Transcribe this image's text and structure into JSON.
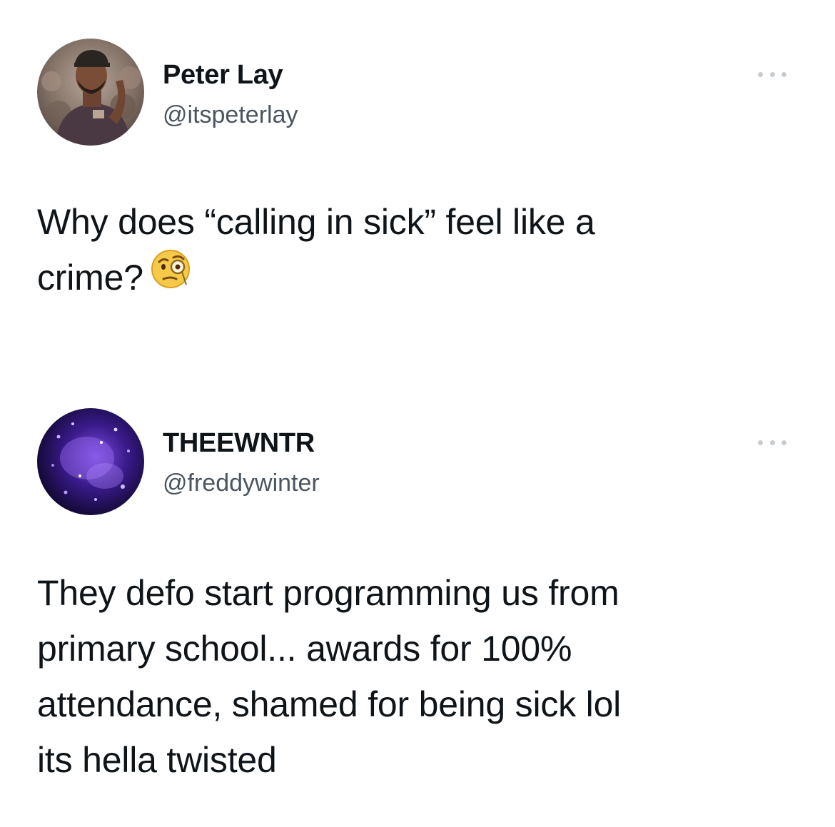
{
  "tweets": [
    {
      "display_name": "Peter Lay",
      "handle": "@itspeterlay",
      "text_lines": [
        "Why does “calling in sick” feel like a",
        "crime?"
      ],
      "emoji": "face-with-monocle-emoji",
      "avatar": "profile-photo-man-in-cap"
    },
    {
      "display_name": "THEEWNTR",
      "handle": "@freddywinter",
      "text_lines": [
        "They defo start programming us from",
        "primary school... awards for 100%",
        "attendance, shamed for being sick lol",
        "its hella twisted"
      ],
      "avatar": "purple-lights-avatar"
    }
  ],
  "more_icon": "more-options-icon",
  "colors": {
    "text": "#0f1419",
    "handle": "#4a5560",
    "dots": "#c8ccd0",
    "background": "#ffffff"
  }
}
